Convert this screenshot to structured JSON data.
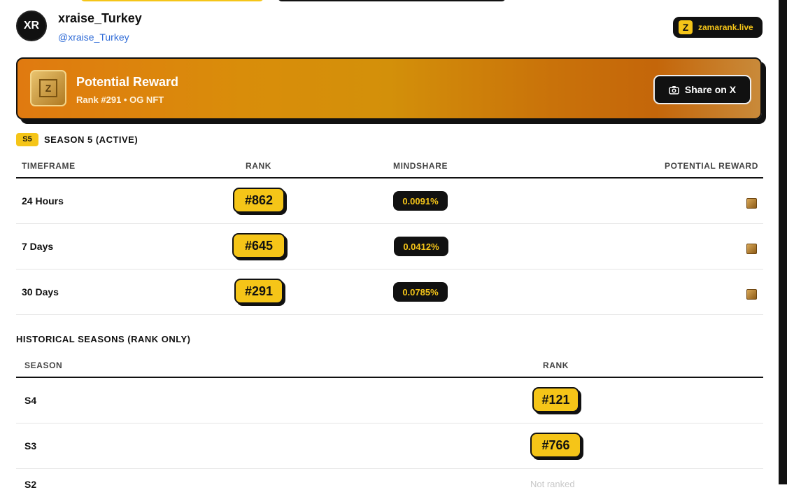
{
  "profile": {
    "avatar_initials": "XR",
    "display_name": "xraise_Turkey",
    "handle": "@xraise_Turkey"
  },
  "brand": {
    "logo_letter": "Z",
    "label": "zamarank.live"
  },
  "reward_card": {
    "badge_letter": "Z",
    "title": "Potential Reward",
    "subtitle": "Rank #291 • OG NFT",
    "share_label": "Share on X"
  },
  "season": {
    "chip": "S5",
    "title": "SEASON 5 (ACTIVE)",
    "columns": [
      "TIMEFRAME",
      "RANK",
      "MINDSHARE",
      "POTENTIAL REWARD"
    ],
    "rows": [
      {
        "timeframe": "24 Hours",
        "rank": "#862",
        "mindshare": "0.0091%"
      },
      {
        "timeframe": "7 Days",
        "rank": "#645",
        "mindshare": "0.0412%"
      },
      {
        "timeframe": "30 Days",
        "rank": "#291",
        "mindshare": "0.0785%"
      }
    ]
  },
  "historical": {
    "title": "HISTORICAL SEASONS (RANK ONLY)",
    "columns": [
      "SEASON",
      "RANK"
    ],
    "rows": [
      {
        "season": "S4",
        "rank": "#121"
      },
      {
        "season": "S3",
        "rank": "#766"
      },
      {
        "season": "S2",
        "rank": "Not ranked"
      }
    ]
  },
  "colors": {
    "accent": "#f5c518",
    "ink": "#111111",
    "link": "#2f6bd7"
  }
}
